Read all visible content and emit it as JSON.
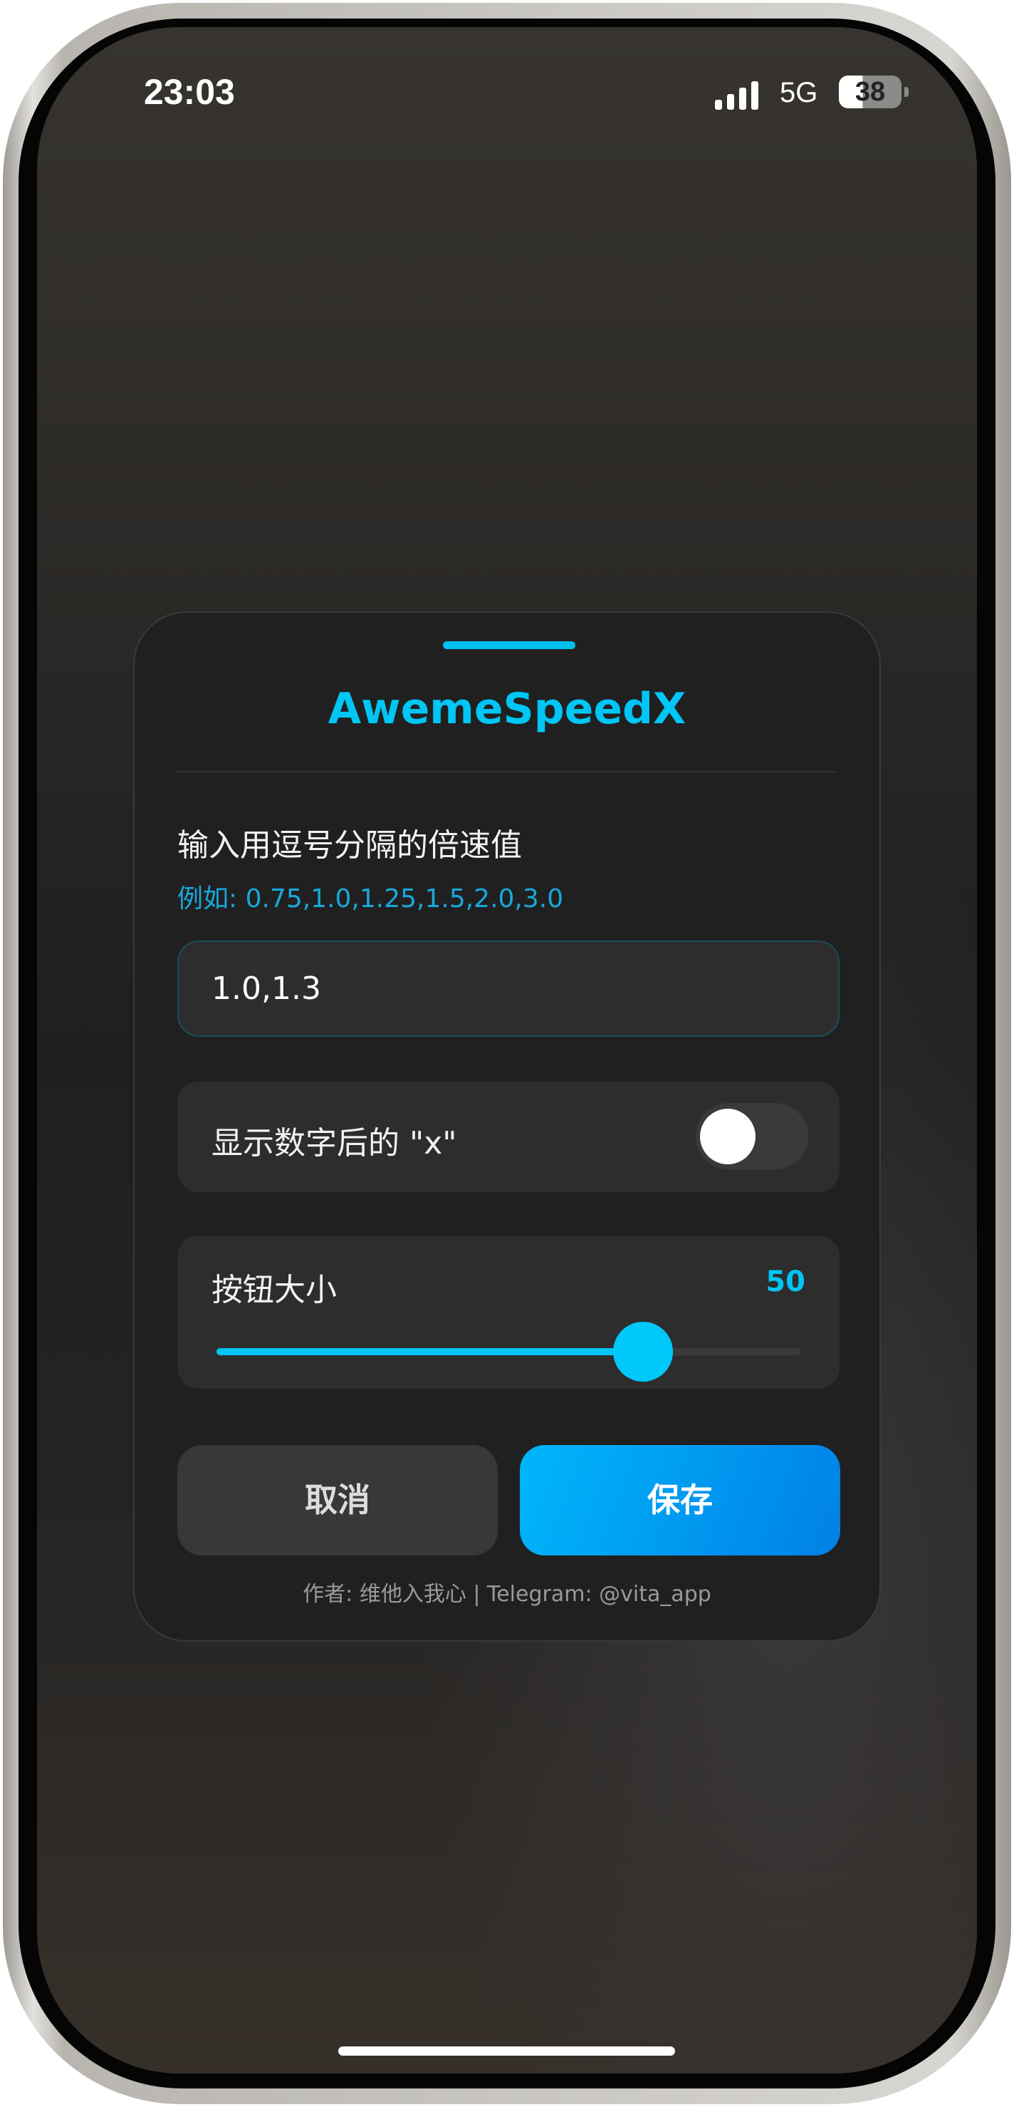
{
  "status_bar": {
    "time": "23:03",
    "network": "5G",
    "battery": "38",
    "battery_level": 0.38
  },
  "dialog": {
    "title": "AwemeSpeedX",
    "speeds_label": "输入用逗号分隔的倍速值",
    "speeds_example": "例如: 0.75,1.0,1.25,1.5,2.0,3.0",
    "speeds_input_value": "1.0,1.3",
    "show_x_label": "显示数字后的 \"x\"",
    "show_x_enabled": false,
    "button_size_label": "按钮大小",
    "button_size_value": "50",
    "button_size_slider_fraction": 0.73,
    "cancel_label": "取消",
    "save_label": "保存",
    "footer": "作者: 维他入我心 | Telegram: @vita_app"
  },
  "colors": {
    "accent": "#00c6f5",
    "save_gradient_end": "#0080e6"
  }
}
